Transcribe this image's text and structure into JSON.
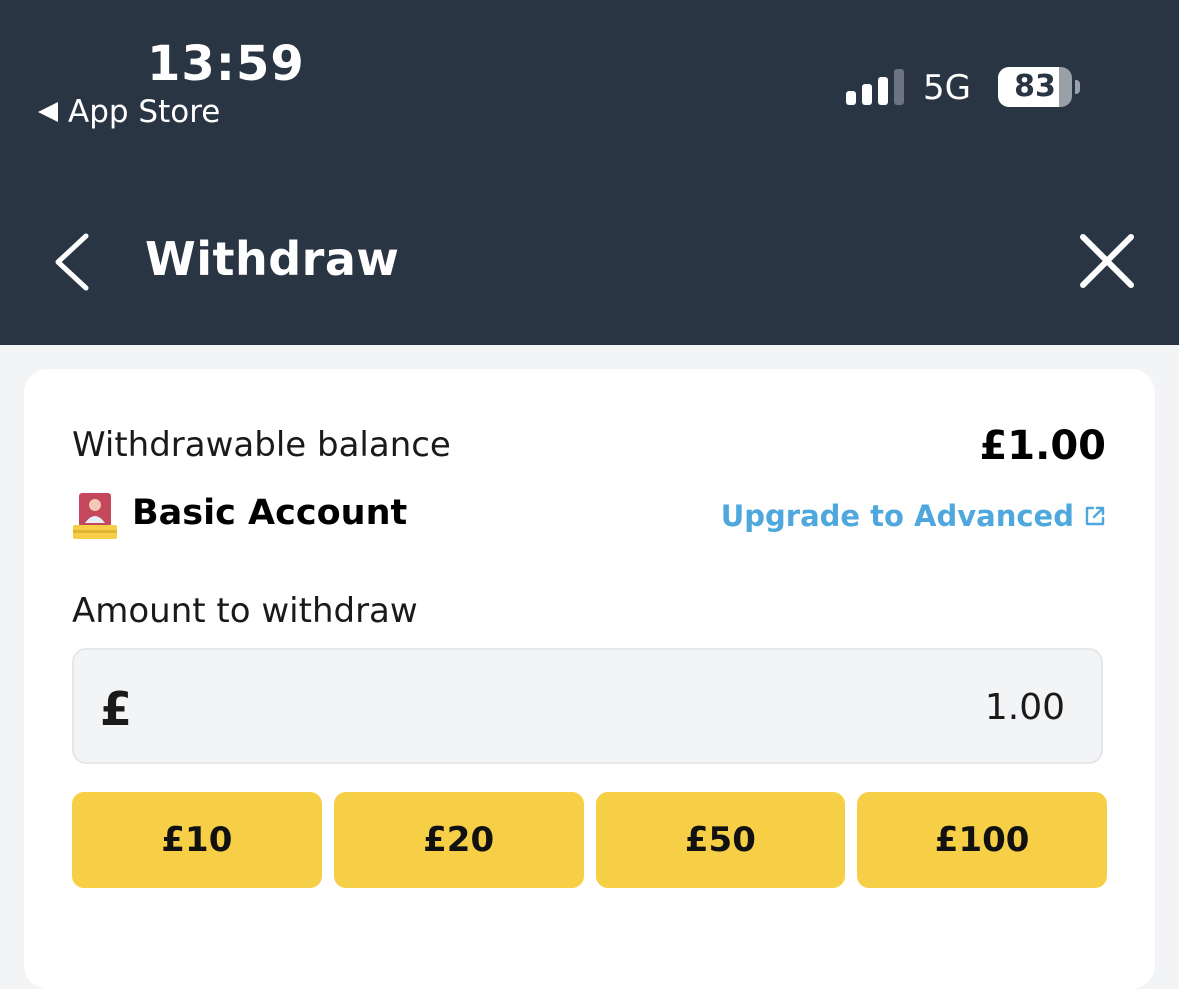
{
  "status_bar": {
    "time": "13:59",
    "back_app": "App Store",
    "network": "5G",
    "battery": "83",
    "battery_level": 0.83,
    "signal_bars_active": 3
  },
  "nav": {
    "title": "Withdraw",
    "back_icon": "chevron-left-icon",
    "close_icon": "close-icon"
  },
  "balance": {
    "label": "Withdrawable balance",
    "value": "£1.00"
  },
  "account": {
    "label": "Basic Account",
    "upgrade_link": "Upgrade to Advanced",
    "link_color": "#4ea8dd"
  },
  "amount": {
    "label": "Amount to withdraw",
    "currency_symbol": "£",
    "value": "1.00"
  },
  "quick_amounts": [
    {
      "label": "£10"
    },
    {
      "label": "£20"
    },
    {
      "label": "£50"
    },
    {
      "label": "£100"
    }
  ],
  "colors": {
    "header_bg": "#2a3544",
    "button_yellow": "#f6cf47",
    "page_bg": "#f3f4f6"
  }
}
